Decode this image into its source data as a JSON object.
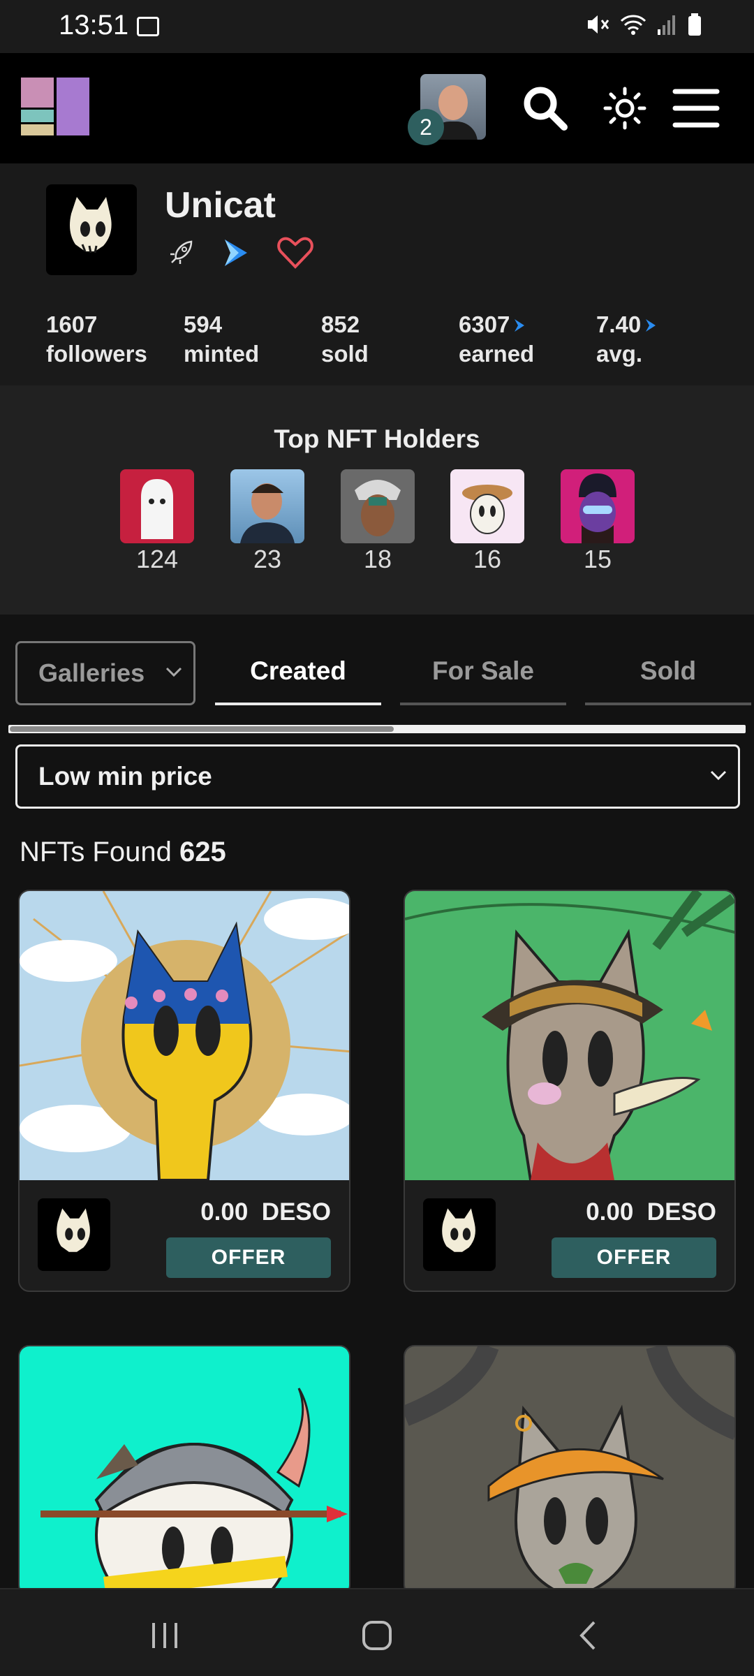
{
  "status_bar": {
    "time": "13:51"
  },
  "header": {
    "notification_count": "2"
  },
  "profile": {
    "name": "Unicat",
    "stats": [
      {
        "value": "1607",
        "label": "followers"
      },
      {
        "value": "594",
        "label": "minted"
      },
      {
        "value": "852",
        "label": "sold"
      },
      {
        "value": "6307",
        "label": "earned"
      },
      {
        "value": "7.40",
        "label": "avg."
      }
    ]
  },
  "holders": {
    "title": "Top NFT Holders",
    "counts": [
      "124",
      "23",
      "18",
      "16",
      "15"
    ]
  },
  "tabs": {
    "galleries": "Galleries",
    "created": "Created",
    "for_sale": "For Sale",
    "sold": "Sold"
  },
  "sort": {
    "selected": "Low min price"
  },
  "results": {
    "label": "NFTs Found",
    "count": "625"
  },
  "cards": [
    {
      "price": "0.00",
      "currency": "DESO",
      "action": "OFFER"
    },
    {
      "price": "0.00",
      "currency": "DESO",
      "action": "OFFER"
    }
  ],
  "colors": {
    "accent": "#2e5f5f",
    "heart": "#e8505b",
    "deso_blue": "#2a8cf0"
  }
}
